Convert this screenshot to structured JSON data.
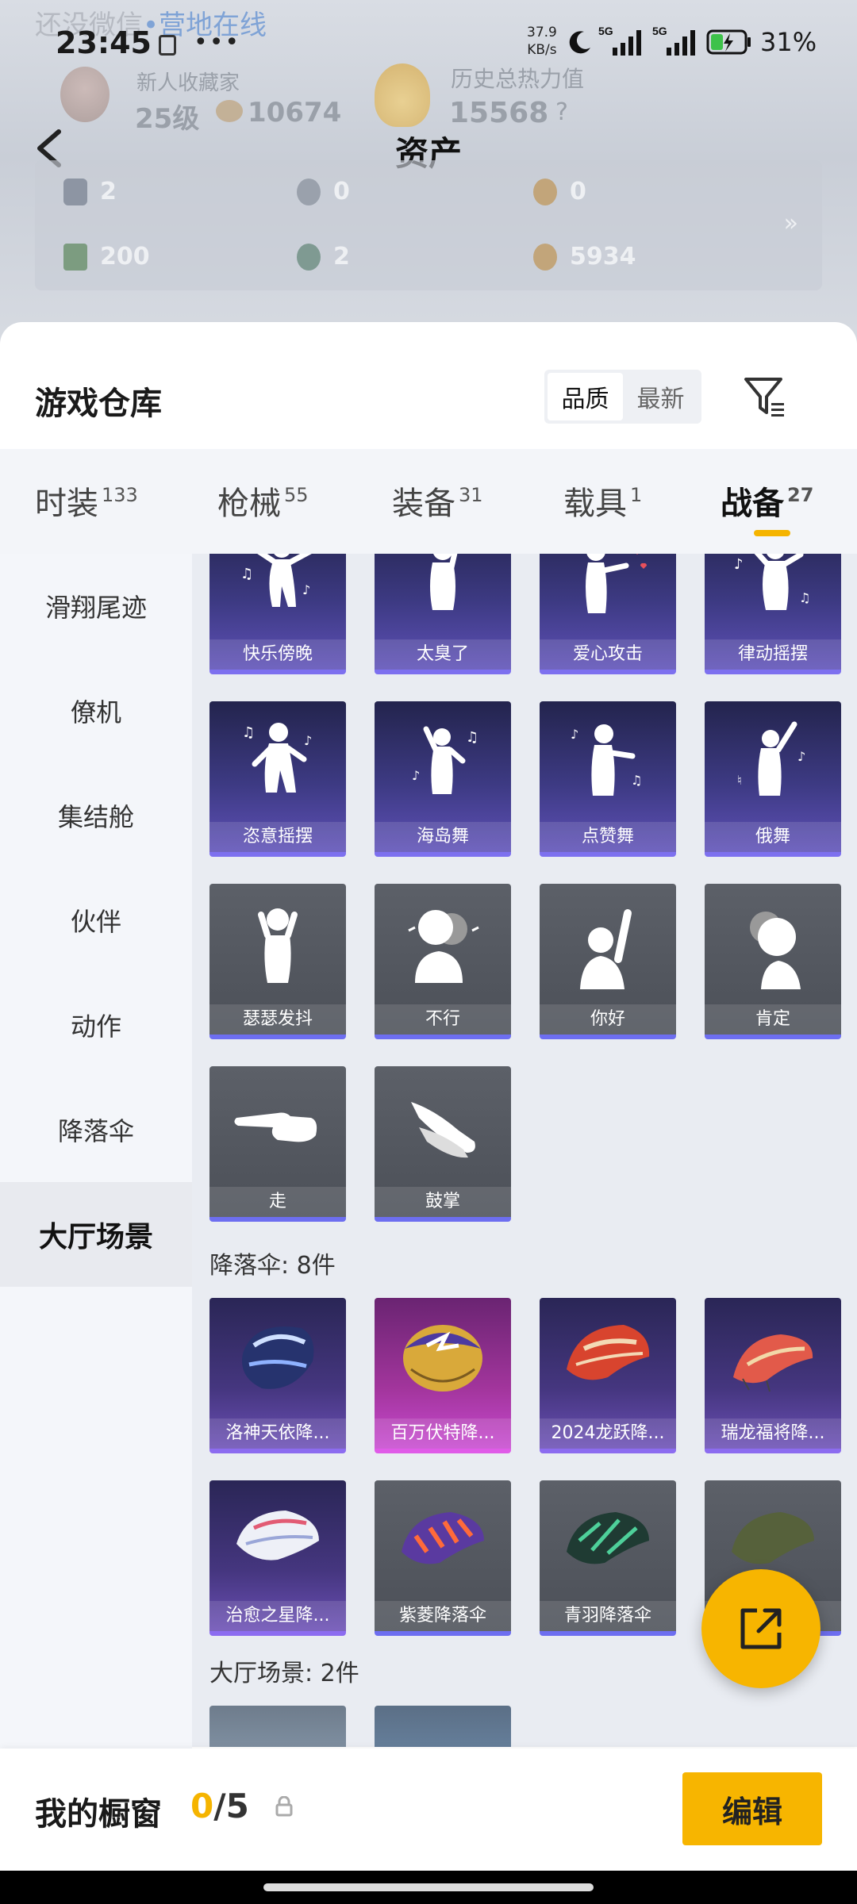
{
  "status_bar": {
    "time": "23:45",
    "dots": "•••",
    "speed_value": "37.9",
    "speed_unit": "KB/s",
    "net1": "5G",
    "net2": "5G",
    "battery": "31%"
  },
  "ghost_header": {
    "app_partial": "还没微信",
    "camp_text": "•营地在线",
    "rank_title": "新人收藏家",
    "level": "25级",
    "coins": "10674",
    "history_label": "历史总热力值",
    "history_value": "15568",
    "help": "?"
  },
  "page_title": "资产",
  "assets": [
    {
      "value": "2"
    },
    {
      "value": "0"
    },
    {
      "value": "0"
    },
    {
      "value": "200"
    },
    {
      "value": "2"
    },
    {
      "value": "5934"
    }
  ],
  "assets_more": "»",
  "warehouse": {
    "title": "游戏仓库",
    "sort_quality": "品质",
    "sort_latest": "最新"
  },
  "tabs": [
    {
      "label": "时装",
      "count": "133"
    },
    {
      "label": "枪械",
      "count": "55"
    },
    {
      "label": "装备",
      "count": "31"
    },
    {
      "label": "载具",
      "count": "1"
    },
    {
      "label": "战备",
      "count": "27"
    }
  ],
  "sidebar": [
    {
      "label": "滑翔尾迹"
    },
    {
      "label": "僚机"
    },
    {
      "label": "集结舱"
    },
    {
      "label": "伙伴"
    },
    {
      "label": "动作"
    },
    {
      "label": "降落伞"
    },
    {
      "label": "大厅场景"
    }
  ],
  "actions": [
    {
      "label": "快乐傍晚"
    },
    {
      "label": "太臭了"
    },
    {
      "label": "爱心攻击"
    },
    {
      "label": "律动摇摆"
    },
    {
      "label": "恣意摇摆"
    },
    {
      "label": "海岛舞"
    },
    {
      "label": "点赞舞"
    },
    {
      "label": "俄舞"
    },
    {
      "label": "瑟瑟发抖"
    },
    {
      "label": "不行"
    },
    {
      "label": "你好"
    },
    {
      "label": "肯定"
    },
    {
      "label": "走"
    },
    {
      "label": "鼓掌"
    }
  ],
  "parachute_section": "降落伞: 8件",
  "parachutes": [
    {
      "label": "洛神天依降..."
    },
    {
      "label": "百万伏特降..."
    },
    {
      "label": "2024龙跃降..."
    },
    {
      "label": "瑞龙福将降..."
    },
    {
      "label": "治愈之星降..."
    },
    {
      "label": "紫菱降落伞"
    },
    {
      "label": "青羽降落伞"
    }
  ],
  "lobby_section": "大厅场景: 2件",
  "bottom": {
    "title": "我的橱窗",
    "current": "0",
    "total": "/5",
    "edit": "编辑"
  }
}
